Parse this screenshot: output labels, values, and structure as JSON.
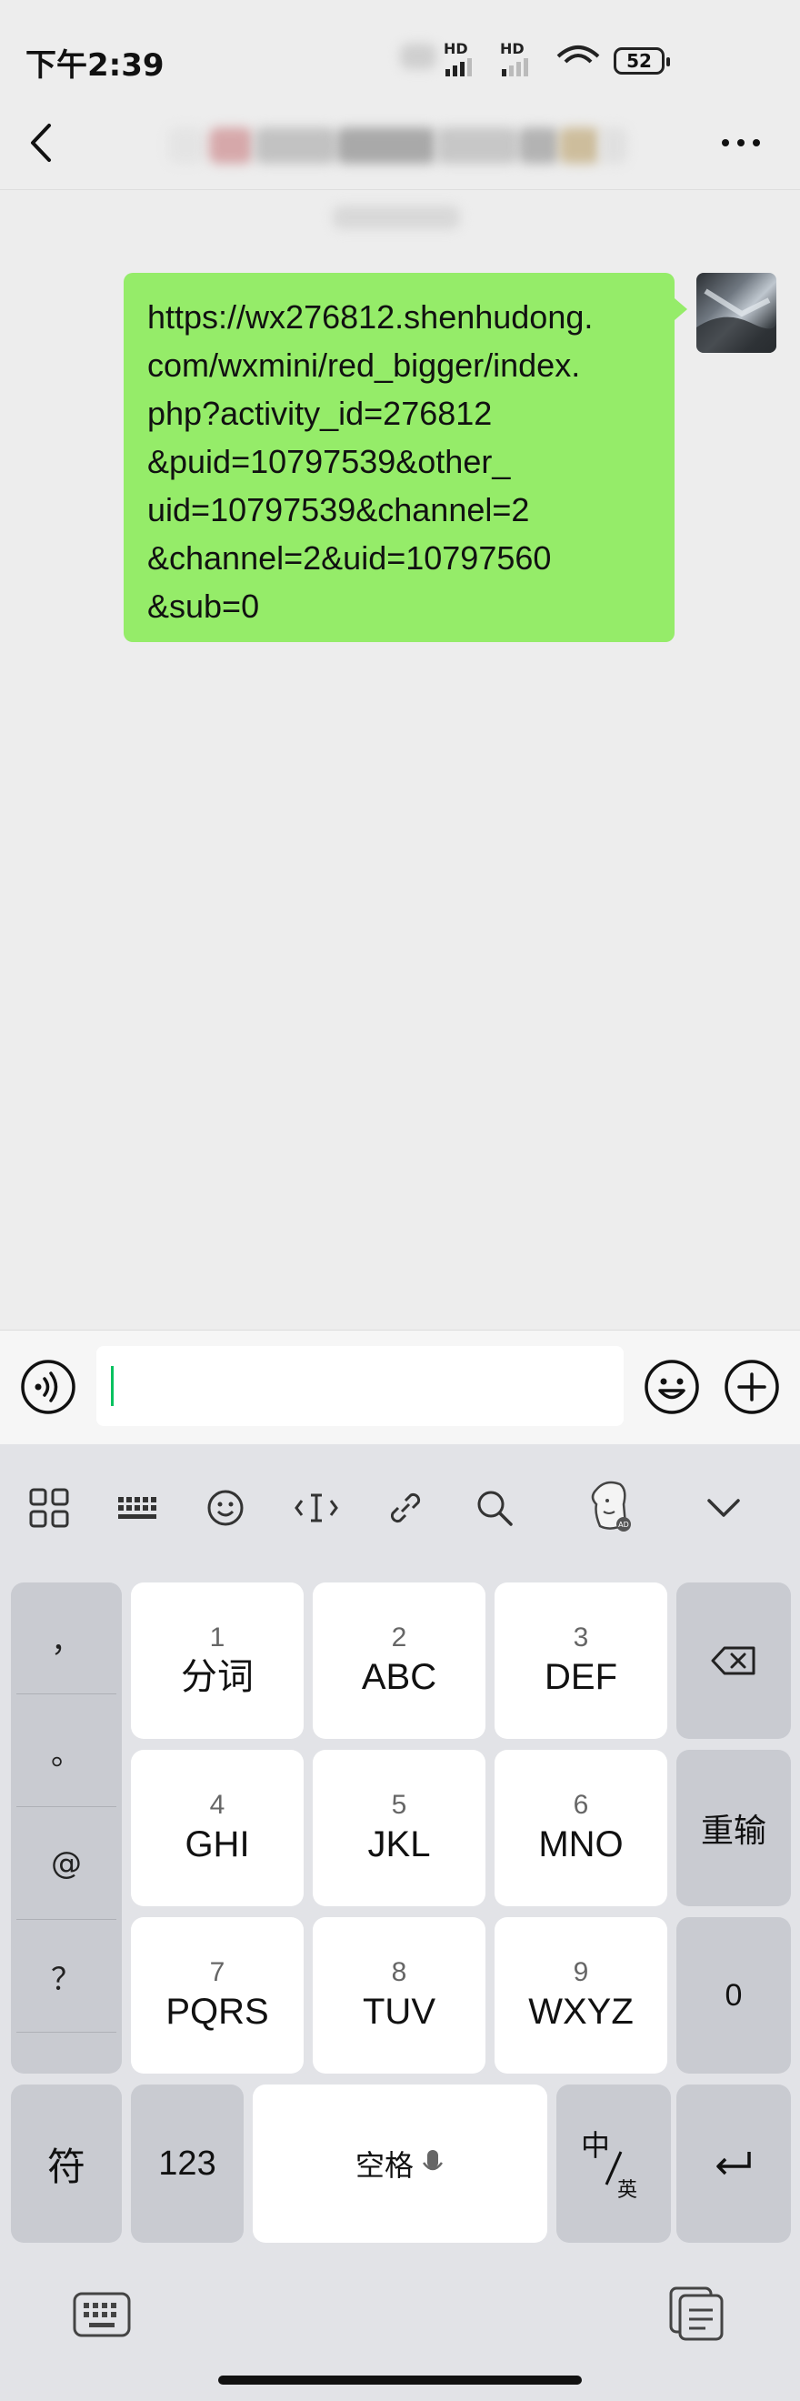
{
  "status_bar": {
    "time": "下午2:39",
    "network_1": "HD",
    "network_2": "HD",
    "battery": "52"
  },
  "chat": {
    "message_text": "https://wx276812.shenhudong.\ncom/wxmini/red_bigger/index.\nphp?activity_id=276812\n&puid=10797539&other_\nuid=10797539&channel=2\n&channel=2&uid=10797560\n&sub=0",
    "bubble_color": "#95ec69"
  },
  "input": {
    "value": ""
  },
  "keyboard": {
    "side_symbols": [
      "，",
      "。",
      "@",
      "？"
    ],
    "keys": [
      {
        "num": "1",
        "letters": "分词"
      },
      {
        "num": "2",
        "letters": "ABC"
      },
      {
        "num": "3",
        "letters": "DEF"
      },
      {
        "num": "4",
        "letters": "GHI"
      },
      {
        "num": "5",
        "letters": "JKL"
      },
      {
        "num": "6",
        "letters": "MNO"
      },
      {
        "num": "7",
        "letters": "PQRS"
      },
      {
        "num": "8",
        "letters": "TUV"
      },
      {
        "num": "9",
        "letters": "WXYZ"
      }
    ],
    "retype_label": "重输",
    "zero_label": "0",
    "symbols_label": "符",
    "numbers_label": "123",
    "space_label": "空格",
    "lang_top": "中",
    "lang_bottom": "英"
  }
}
